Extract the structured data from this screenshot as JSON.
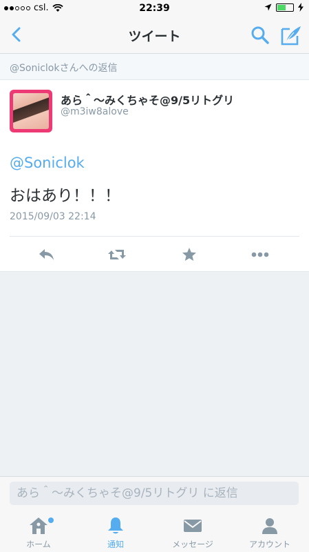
{
  "status_bar": {
    "carrier": "csl.",
    "time": "22:39"
  },
  "nav": {
    "title": "ツイート"
  },
  "reply_context": "@Soniclokさんへの返信",
  "tweet": {
    "author_name": "あら＾〜みくちゃそ@9/5リトグリ",
    "author_handle": "@m3iw8alove",
    "mention": "@Soniclok",
    "text": "おはあり！！！",
    "timestamp": "2015/09/03 22:14"
  },
  "reply_bar": {
    "placeholder": "あら＾〜みくちゃそ@9/5リトグリ に返信"
  },
  "tabs": [
    {
      "label": "ホーム",
      "icon": "home-icon",
      "active": false,
      "badge": true
    },
    {
      "label": "通知",
      "icon": "bell-icon",
      "active": true,
      "badge": false
    },
    {
      "label": "メッセージ",
      "icon": "envelope-icon",
      "active": false,
      "badge": false
    },
    {
      "label": "アカウント",
      "icon": "person-icon",
      "active": false,
      "badge": false
    }
  ],
  "colors": {
    "accent": "#55acee",
    "muted": "#8899a6",
    "icon_gray": "#8899a6",
    "avatar_frame": "#ee3a74"
  }
}
